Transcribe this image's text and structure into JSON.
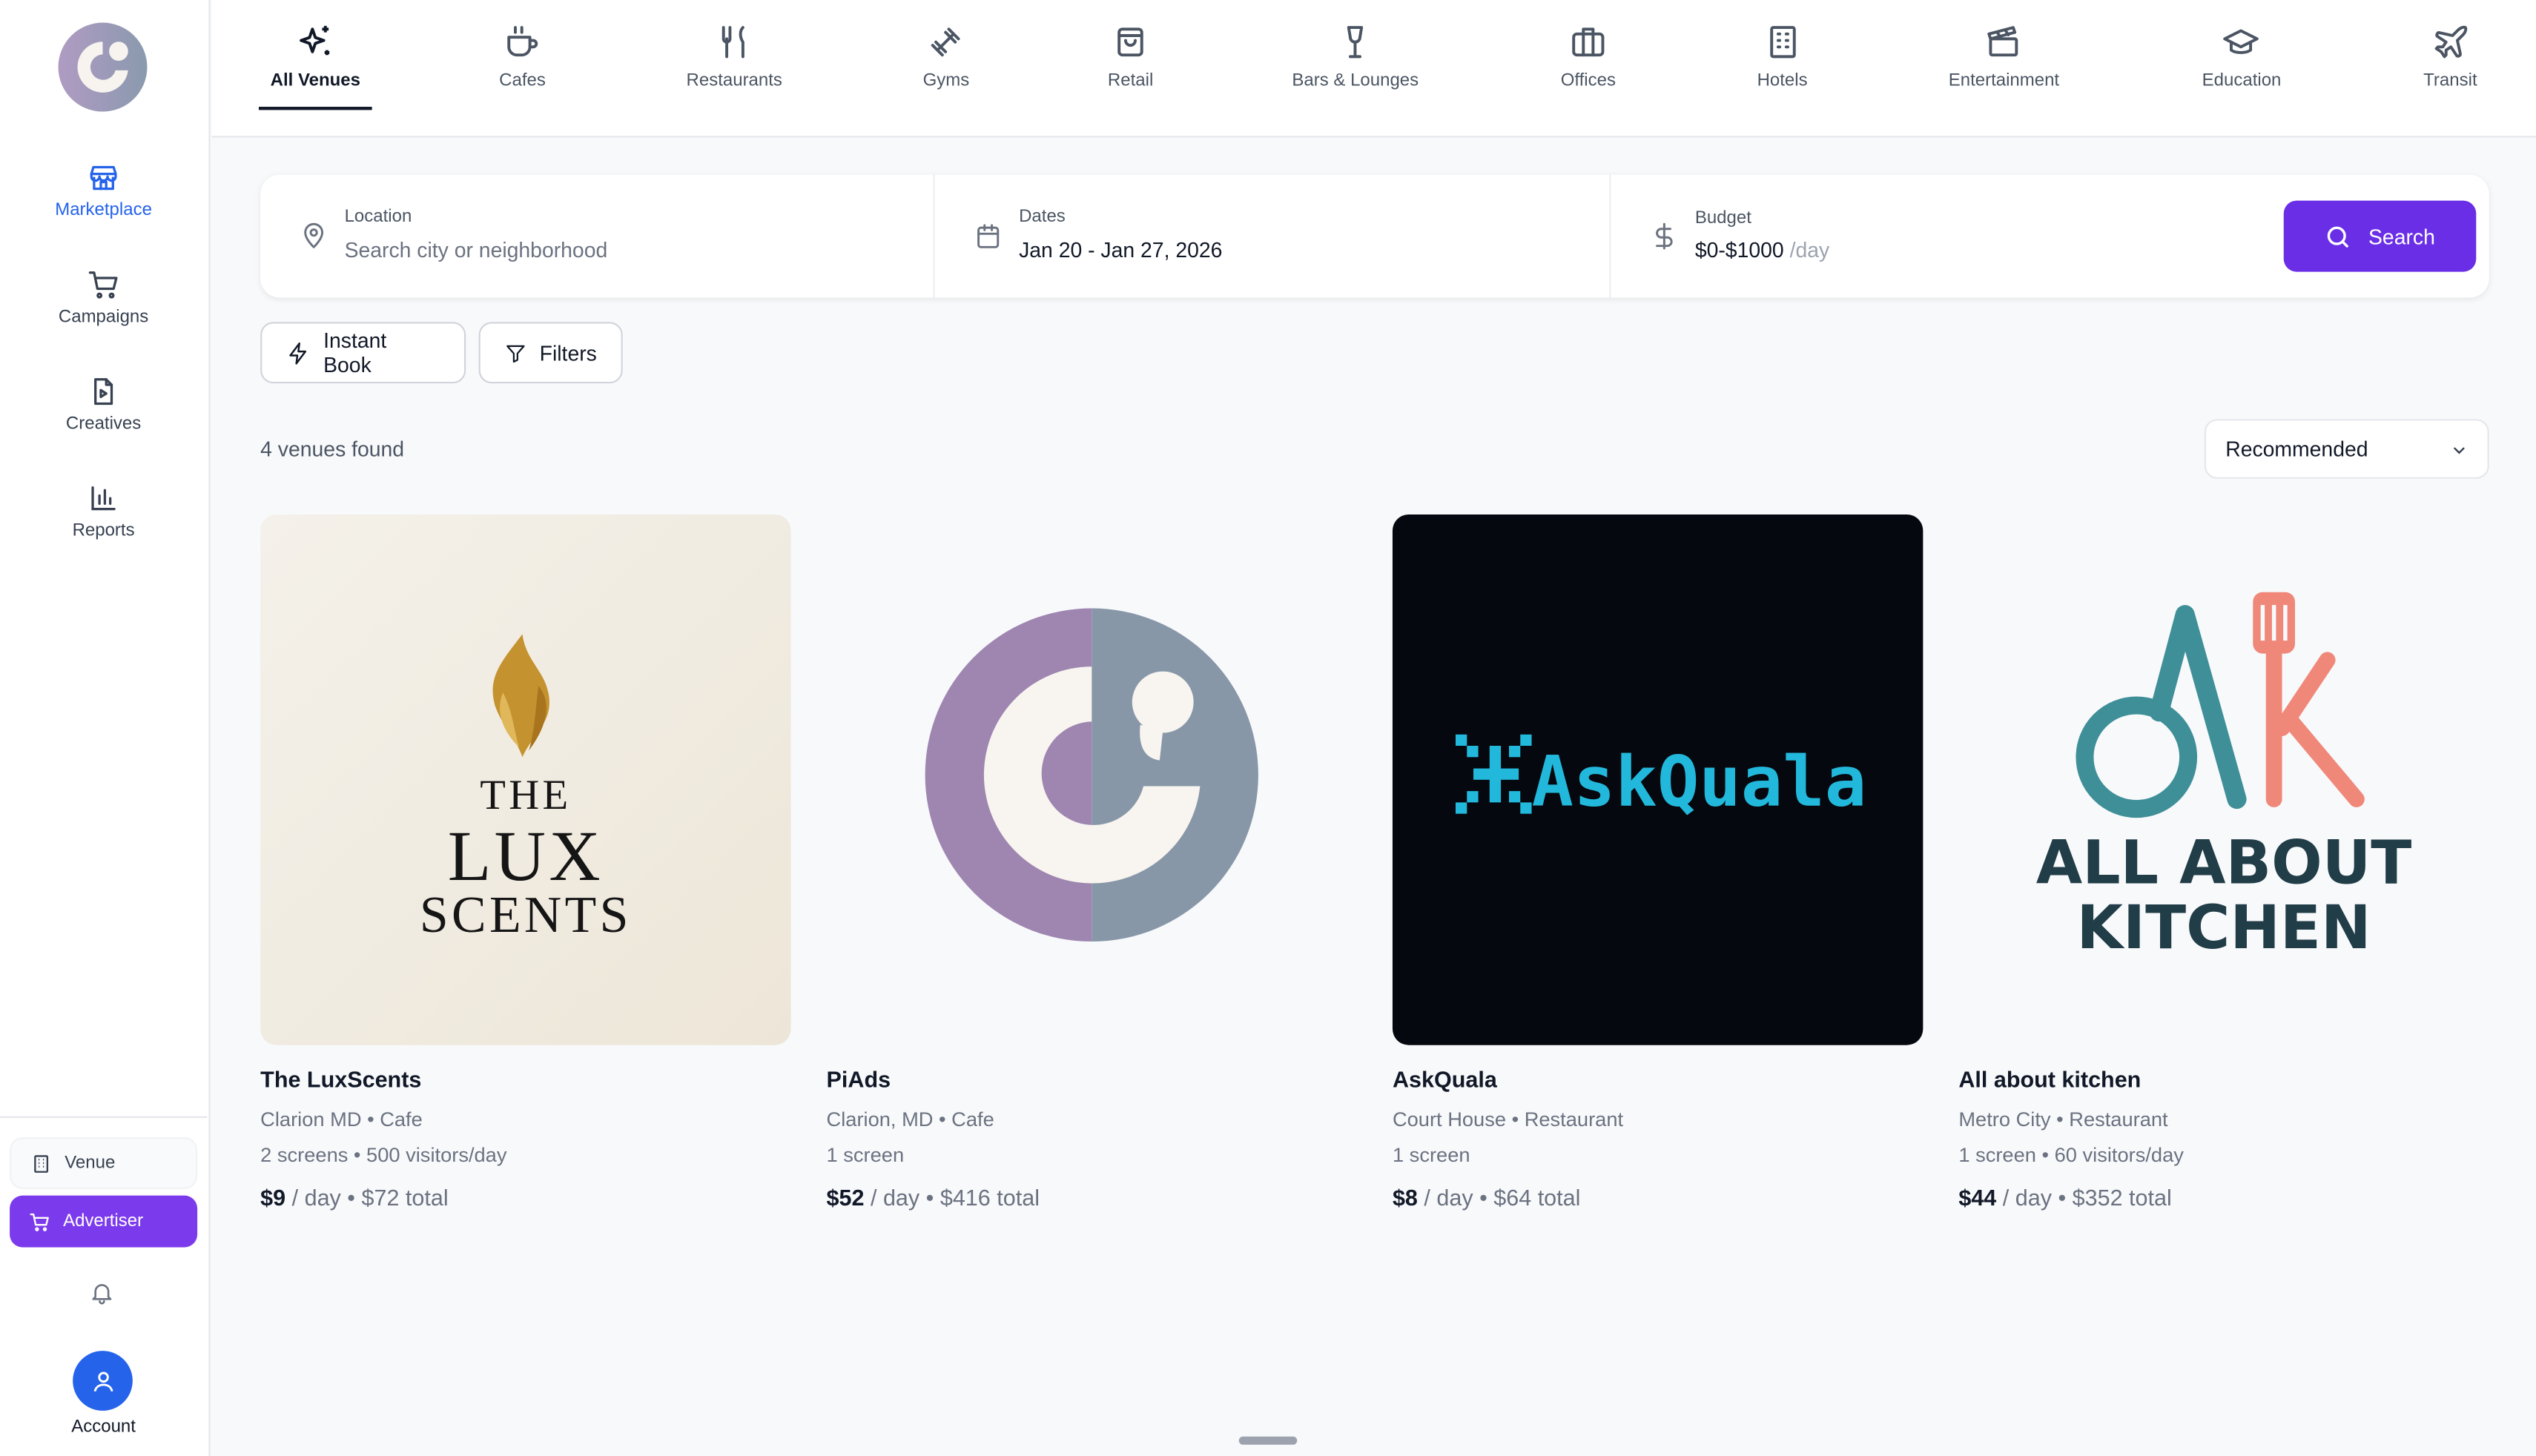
{
  "sidebar": {
    "items": [
      {
        "label": "Marketplace",
        "icon": "store-icon"
      },
      {
        "label": "Campaigns",
        "icon": "cart-icon"
      },
      {
        "label": "Creatives",
        "icon": "file-play-icon"
      },
      {
        "label": "Reports",
        "icon": "bar-chart-icon"
      }
    ],
    "roles": {
      "venue": "Venue",
      "advertiser": "Advertiser"
    },
    "account_label": "Account"
  },
  "categories": [
    {
      "label": "All Venues",
      "icon": "sparkles-icon"
    },
    {
      "label": "Cafes",
      "icon": "coffee-cup-icon"
    },
    {
      "label": "Restaurants",
      "icon": "utensils-icon"
    },
    {
      "label": "Gyms",
      "icon": "dumbbell-icon"
    },
    {
      "label": "Retail",
      "icon": "shopping-bag-icon"
    },
    {
      "label": "Bars & Lounges",
      "icon": "wine-glass-icon"
    },
    {
      "label": "Offices",
      "icon": "briefcase-icon"
    },
    {
      "label": "Hotels",
      "icon": "building-icon"
    },
    {
      "label": "Entertainment",
      "icon": "clapperboard-icon"
    },
    {
      "label": "Education",
      "icon": "graduation-cap-icon"
    },
    {
      "label": "Transit",
      "icon": "plane-icon"
    }
  ],
  "search": {
    "location_label": "Location",
    "location_placeholder": "Search city or neighborhood",
    "dates_label": "Dates",
    "dates_value": "Jan 20 - Jan 27, 2026",
    "budget_label": "Budget",
    "budget_value": "$0-$1000",
    "budget_unit": "/day",
    "button_label": "Search"
  },
  "filters": {
    "instant_book": "Instant Book",
    "filters": "Filters"
  },
  "results": {
    "count_text": "4 venues found",
    "sort_value": "Recommended"
  },
  "venues": [
    {
      "name": "The LuxScents",
      "location_line": "Clarion MD • Cafe",
      "stats_line": "2 screens • 500 visitors/day",
      "price": "$9",
      "price_suffix": " / day • $72 total",
      "logo_text": [
        "THE",
        "LUX",
        "SCENTS"
      ]
    },
    {
      "name": "PiAds",
      "location_line": "Clarion, MD • Cafe",
      "stats_line": "1 screen",
      "price": "$52",
      "price_suffix": " / day • $416 total"
    },
    {
      "name": "AskQuala",
      "location_line": "Court House • Restaurant",
      "stats_line": "1 screen",
      "price": "$8",
      "price_suffix": " / day • $64 total",
      "logo_text": "AskQuala"
    },
    {
      "name": "All about kitchen",
      "location_line": "Metro City • Restaurant",
      "stats_line": "1 screen • 60 visitors/day",
      "price": "$44",
      "price_suffix": " / day • $352 total",
      "logo_text": [
        "ALL ABOUT",
        "KITCHEN"
      ]
    }
  ],
  "colors": {
    "accent_purple": "#6a2ee6",
    "active_blue": "#2563eb",
    "advertiser_purple": "#7c3aed"
  }
}
